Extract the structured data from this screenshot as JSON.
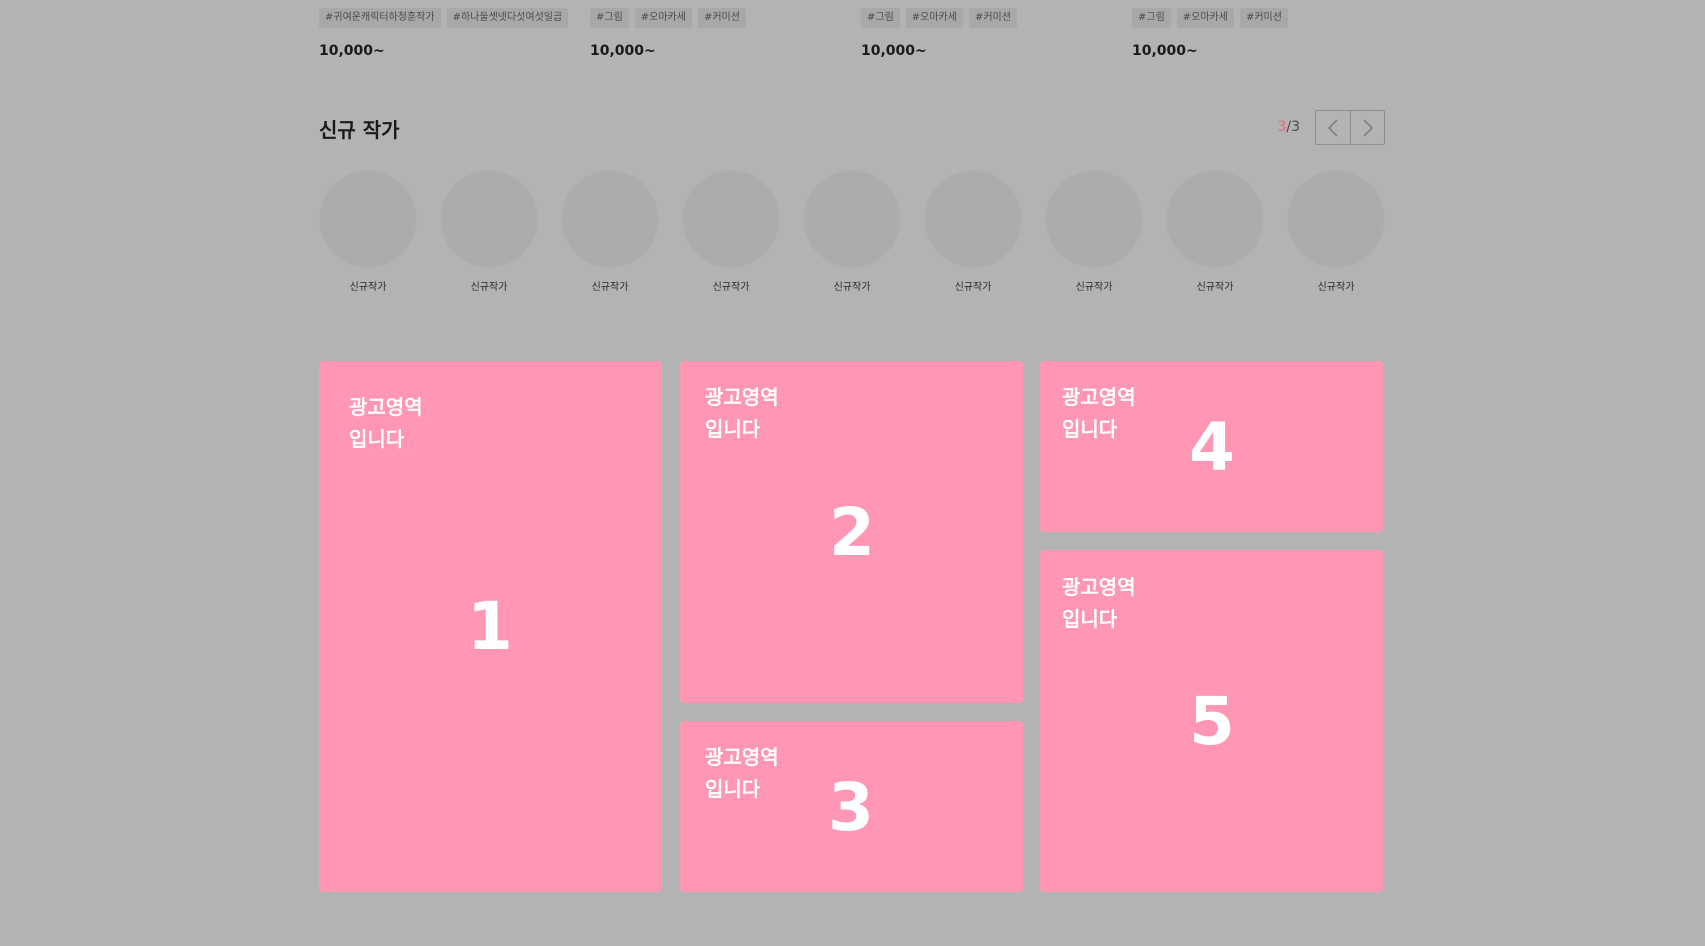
{
  "products": [
    {
      "tags": [
        "#귀여운캐릭터하청훈작가",
        "#하나둘셋넷다섯여섯일곱"
      ],
      "price": "10,000~"
    },
    {
      "tags": [
        "#그림",
        "#오마카세",
        "#커미션"
      ],
      "price": "10,000~"
    },
    {
      "tags": [
        "#그림",
        "#오마카세",
        "#커미션"
      ],
      "price": "10,000~"
    },
    {
      "tags": [
        "#그림",
        "#오마카세",
        "#커미션"
      ],
      "price": "10,000~"
    }
  ],
  "new_artists": {
    "title": "신규 작가",
    "pager": {
      "current": "3",
      "separator": "/",
      "total": "3"
    },
    "prev_icon": "chevron-left-icon",
    "next_icon": "chevron-right-icon",
    "artists": [
      "신규작가",
      "신규작가",
      "신규작가",
      "신규작가",
      "신규작가",
      "신규작가",
      "신규작가",
      "신규작가",
      "신규작가"
    ]
  },
  "ads": [
    {
      "label": "광고영역\n입니다",
      "number": "1"
    },
    {
      "label": "광고영역\n입니다",
      "number": "2"
    },
    {
      "label": "광고영역\n입니다",
      "number": "3"
    },
    {
      "label": "광고영역\n입니다",
      "number": "4"
    },
    {
      "label": "광고영역\n입니다",
      "number": "5"
    }
  ],
  "colors": {
    "background": "#b3b3b3",
    "ad": "#ff96b3",
    "pager_current": "#e0707f"
  }
}
